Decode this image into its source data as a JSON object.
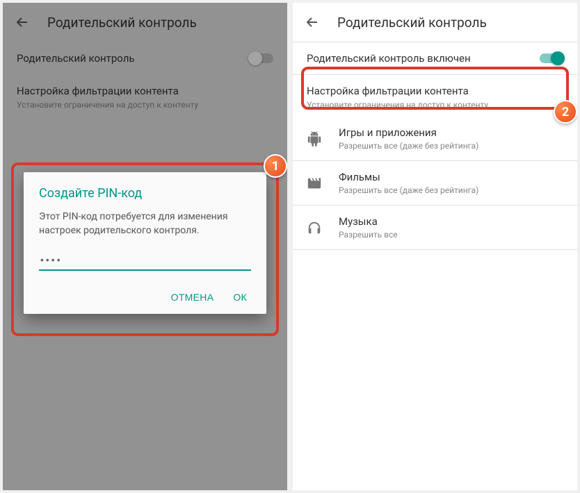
{
  "left": {
    "header": {
      "title": "Родительский контроль"
    },
    "toggleRow": {
      "label": "Родительский контроль"
    },
    "section": {
      "title": "Настройка фильтрации контента",
      "sub": "Установите ограничения на доступ к контенту"
    },
    "dialog": {
      "title": "Создайте PIN-код",
      "body": "Этот PIN-код потребуется для изменения настроек родительского контроля.",
      "pinValue": "••••",
      "cancel": "ОТМЕНА",
      "ok": "ОК"
    },
    "badge": "1"
  },
  "right": {
    "header": {
      "title": "Родительский контроль"
    },
    "toggleRow": {
      "label": "Родительский контроль включен"
    },
    "section": {
      "title": "Настройка фильтрации контента",
      "sub": "Установите ограничения на доступ к контенту"
    },
    "items": [
      {
        "title": "Игры и приложения",
        "sub": "Разрешить все (даже без рейтинга)"
      },
      {
        "title": "Фильмы",
        "sub": "Разрешить все (даже без рейтинга)"
      },
      {
        "title": "Музыка",
        "sub": "Разрешить все"
      }
    ],
    "badge": "2"
  }
}
